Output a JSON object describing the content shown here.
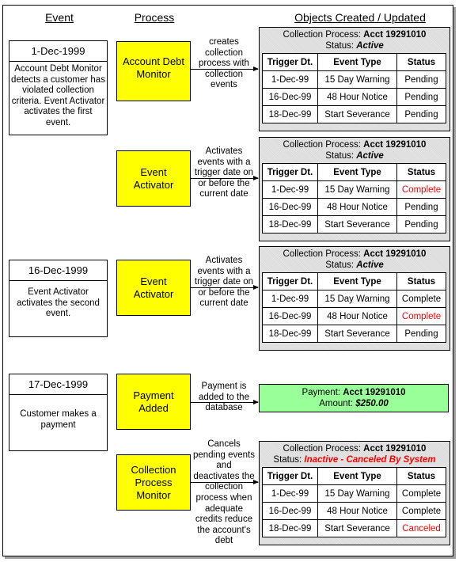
{
  "headers": {
    "event": "Event",
    "process": "Process",
    "objects": "Objects Created / Updated"
  },
  "colors": {
    "process_fill": "#ffff00",
    "payment_fill": "#99ff99",
    "panel_fill": "#d9d9d9",
    "highlight": "#ff0000"
  },
  "table_headers": [
    "Trigger Dt.",
    "Event Type",
    "Status"
  ],
  "events": [
    {
      "date": "1-Dec-1999",
      "description": "Account Debt Monitor detects a customer has violated collection criteria.  Event Activator activates the first event."
    },
    {
      "date": "16-Dec-1999",
      "description": "Event Activator activates the second event."
    },
    {
      "date": "17-Dec-1999",
      "description": "Customer makes a payment"
    }
  ],
  "processes": [
    {
      "name_lines": [
        "Account Debt",
        "Monitor"
      ],
      "arrow_label": "creates collection process with collection events"
    },
    {
      "name_lines": [
        "Event",
        "Activator"
      ],
      "arrow_label": "Activates events with a trigger date on or before the current date"
    },
    {
      "name_lines": [
        "Event",
        "Activator"
      ],
      "arrow_label": "Activates events with a trigger date on or before the current date"
    },
    {
      "name_lines": [
        "Payment",
        "Added"
      ],
      "arrow_label": "Payment is added to the database"
    },
    {
      "name_lines": [
        "Collection",
        "Process",
        "Monitor"
      ],
      "arrow_label": "Cancels pending events and deactivates the collection process when adequate credits reduce the account's debt"
    }
  ],
  "panels": [
    {
      "label": "Collection Process: ",
      "acct": "Acct 19291010",
      "status_label": "Status: ",
      "status": "Active",
      "rows": [
        {
          "date": "1-Dec-99",
          "type": "15 Day Warning",
          "status": "Pending",
          "changed": false
        },
        {
          "date": "16-Dec-99",
          "type": "48 Hour Notice",
          "status": "Pending",
          "changed": false
        },
        {
          "date": "18-Dec-99",
          "type": "Start Severance",
          "status": "Pending",
          "changed": false
        }
      ]
    },
    {
      "label": "Collection Process: ",
      "acct": "Acct 19291010",
      "status_label": "Status: ",
      "status": "Active",
      "rows": [
        {
          "date": "1-Dec-99",
          "type": "15 Day Warning",
          "status": "Complete",
          "changed": true
        },
        {
          "date": "16-Dec-99",
          "type": "48 Hour Notice",
          "status": "Pending",
          "changed": false
        },
        {
          "date": "18-Dec-99",
          "type": "Start Severance",
          "status": "Pending",
          "changed": false
        }
      ]
    },
    {
      "label": "Collection Process: ",
      "acct": "Acct 19291010",
      "status_label": "Status: ",
      "status": "Active",
      "rows": [
        {
          "date": "1-Dec-99",
          "type": "15 Day Warning",
          "status": "Complete",
          "changed": false
        },
        {
          "date": "16-Dec-99",
          "type": "48 Hour Notice",
          "status": "Complete",
          "changed": true
        },
        {
          "date": "18-Dec-99",
          "type": "Start Severance",
          "status": "Pending",
          "changed": false
        }
      ]
    },
    {
      "label": "Collection Process: ",
      "acct": "Acct 19291010",
      "status_label": "Status: ",
      "status": "Inactive - Canceled By System",
      "status_changed": true,
      "rows": [
        {
          "date": "1-Dec-99",
          "type": "15 Day Warning",
          "status": "Complete",
          "changed": false
        },
        {
          "date": "16-Dec-99",
          "type": "48 Hour Notice",
          "status": "Complete",
          "changed": false
        },
        {
          "date": "18-Dec-99",
          "type": "Start Severance",
          "status": "Canceled",
          "changed": true
        }
      ]
    }
  ],
  "payment": {
    "label": "Payment: ",
    "acct": "Acct 19291010",
    "amount_label": "Amount: ",
    "amount": "$250.00"
  }
}
